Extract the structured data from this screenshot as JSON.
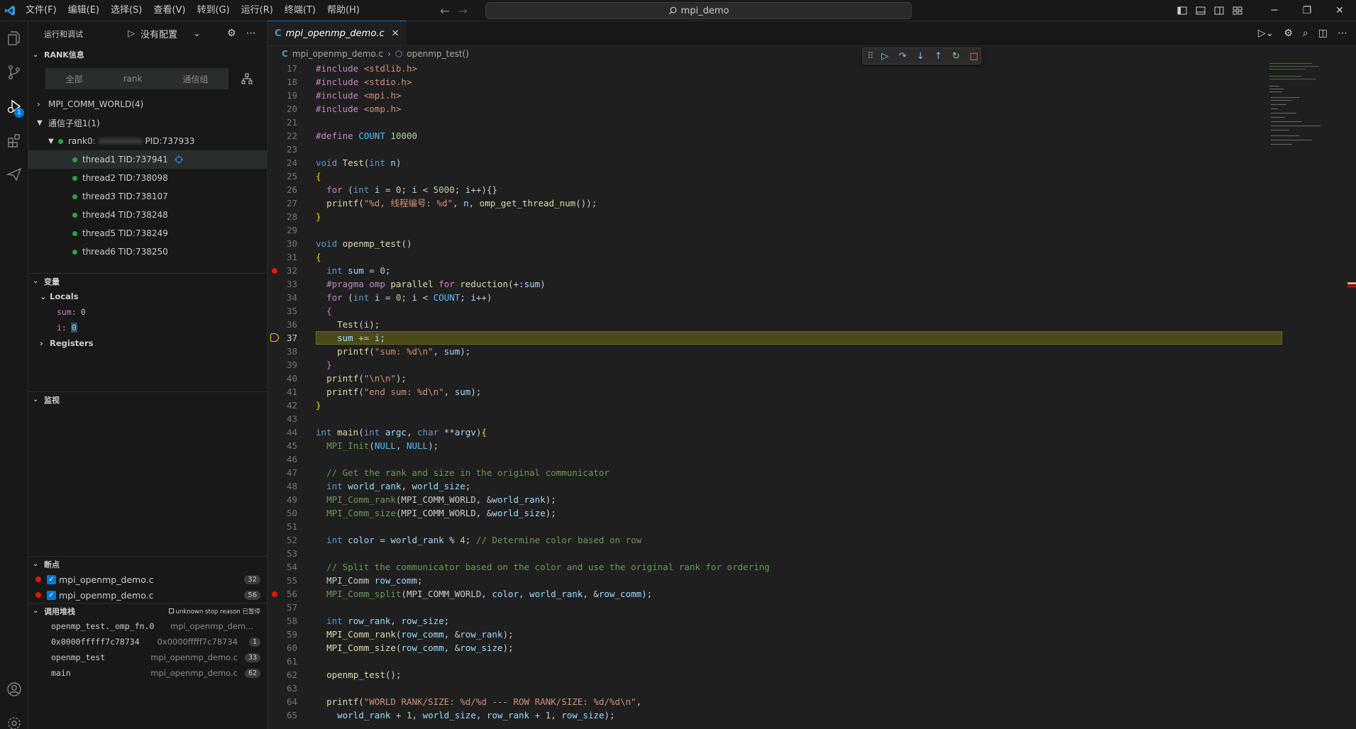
{
  "titlebar": {
    "menu": [
      "文件(F)",
      "编辑(E)",
      "选择(S)",
      "查看(V)",
      "转到(G)",
      "运行(R)",
      "终端(T)",
      "帮助(H)"
    ],
    "search": "mpi_demo"
  },
  "activity": {
    "debug_badge": "1"
  },
  "sidebar": {
    "header_title": "运行和调试",
    "run_config": "没有配置",
    "rank_section": "RANK信息",
    "tabs": [
      "全部",
      "rank",
      "通信组"
    ],
    "comm_world": "MPI_COMM_WORLD(4)",
    "subgroup": "通信子组1(1)",
    "rank_label": "rank0:",
    "pid_label": "PID:737933",
    "threads": [
      "thread1 TID:737941",
      "thread2 TID:738098",
      "thread3 TID:738107",
      "thread4 TID:738248",
      "thread5 TID:738249",
      "thread6 TID:738250"
    ],
    "variables_title": "变量",
    "locals_label": "Locals",
    "locals": [
      {
        "name": "sum:",
        "value": "0"
      },
      {
        "name": "i:",
        "value": "0"
      }
    ],
    "registers_label": "Registers",
    "watch_title": "监视",
    "breakpoints_title": "断点",
    "breakpoints": [
      {
        "file": "mpi_openmp_demo.c",
        "line": "32"
      },
      {
        "file": "mpi_openmp_demo.c",
        "line": "56"
      }
    ],
    "callstack_title": "调用堆栈",
    "callstack_status": "unknown stop reason 已暂停",
    "callstack": [
      {
        "fn": "openmp_test._omp_fn.0",
        "file": "mpi_openmp_dem...",
        "count": ""
      },
      {
        "fn": "0x0000fffff7c78734",
        "file": "0x0000fffff7c78734",
        "count": "1"
      },
      {
        "fn": "openmp_test",
        "file": "mpi_openmp_demo.c",
        "count": "33"
      },
      {
        "fn": "main",
        "file": "mpi_openmp_demo.c",
        "count": "62"
      }
    ]
  },
  "editor": {
    "tab_title": "mpi_openmp_demo.c",
    "breadcrumb_file": "mpi_openmp_demo.c",
    "breadcrumb_symbol": "openmp_test()",
    "current_line": 37,
    "breakpoint_lines": [
      32,
      56
    ],
    "lines": [
      {
        "n": "17",
        "html": "<span class='kw2'>#include</span> <span class='inc'>&lt;stdlib.h&gt;</span>"
      },
      {
        "n": "18",
        "html": "<span class='kw2'>#include</span> <span class='inc'>&lt;stdio.h&gt;</span>"
      },
      {
        "n": "19",
        "html": "<span class='kw2'>#include</span> <span class='inc'>&lt;mpi.h&gt;</span>"
      },
      {
        "n": "20",
        "html": "<span class='kw2'>#include</span> <span class='inc'>&lt;omp.h&gt;</span>"
      },
      {
        "n": "21",
        "html": ""
      },
      {
        "n": "22",
        "html": "<span class='kw2'>#define</span> <span class='mac'>COUNT</span> <span class='num2'>10000</span>"
      },
      {
        "n": "23",
        "html": ""
      },
      {
        "n": "24",
        "html": "<span class='kw'>void</span> <span class='fnc'>Test</span>(<span class='kw'>int</span> <span class='var'>n</span>)"
      },
      {
        "n": "25",
        "html": "<span style='color:#ffd700'>{</span>"
      },
      {
        "n": "26",
        "html": "  <span class='kw2'>for</span> (<span class='kw'>int</span> <span class='var'>i</span> = <span class='num2'>0</span>; <span class='var'>i</span> &lt; <span class='num2'>5000</span>; <span class='var'>i</span>++){}"
      },
      {
        "n": "27",
        "html": "  <span class='fnc'>printf</span>(<span class='str'>\"%d, 线程编号: %d\"</span>, <span class='var'>n</span>, <span class='fnc'>omp_get_thread_num</span>());"
      },
      {
        "n": "28",
        "html": "<span style='color:#ffd700'>}</span>"
      },
      {
        "n": "29",
        "html": ""
      },
      {
        "n": "30",
        "html": "<span class='kw'>void</span> <span class='fnc'>openmp_test</span>()"
      },
      {
        "n": "31",
        "html": "<span style='color:#ffd700'>{</span>"
      },
      {
        "n": "32",
        "html": "  <span class='kw'>int</span> <span class='var'>sum</span> = <span class='num2'>0</span>;"
      },
      {
        "n": "33",
        "html": "  <span class='kw2'>#pragma</span> <span class='kw2'>omp</span> <span class='fnc'>parallel</span> <span class='kw2'>for</span> <span class='fnc'>reduction</span>(+:<span class='var'>sum</span>)"
      },
      {
        "n": "34",
        "html": "  <span class='kw2'>for</span> (<span class='kw'>int</span> <span class='var'>i</span> = <span class='num2'>0</span>; <span class='var'>i</span> &lt; <span class='mac'>COUNT</span>; <span class='var'>i</span>++)"
      },
      {
        "n": "35",
        "html": "  <span style='color:#da70d6'>{</span>"
      },
      {
        "n": "36",
        "html": "    <span class='fnc'>Test</span>(<span class='var'>i</span>);"
      },
      {
        "n": "37",
        "html": "    <span class='var'>sum</span> += <span class='var'>i</span>;"
      },
      {
        "n": "38",
        "html": "    <span class='fnc'>printf</span>(<span class='str'>\"sum: %d\\n\"</span>, <span class='var'>sum</span>);"
      },
      {
        "n": "39",
        "html": "  <span style='color:#da70d6'>}</span>"
      },
      {
        "n": "40",
        "html": "  <span class='fnc'>printf</span>(<span class='str'>\"\\n\\n\"</span>);"
      },
      {
        "n": "41",
        "html": "  <span class='fnc'>printf</span>(<span class='str'>\"end sum: %d\\n\"</span>, <span class='var'>sum</span>);"
      },
      {
        "n": "42",
        "html": "<span style='color:#ffd700'>}</span>"
      },
      {
        "n": "43",
        "html": ""
      },
      {
        "n": "44",
        "html": "<span class='kw'>int</span> <span class='fnc'>main</span>(<span class='kw'>int</span> <span class='var'>argc</span>, <span class='kw'>char</span> **<span class='var'>argv</span>)<span style='color:#ffd700'>{</span>"
      },
      {
        "n": "45",
        "html": "  <span class='cm'>MPI_Init</span>(<span class='mac'>NULL</span>, <span class='mac'>NULL</span>);"
      },
      {
        "n": "46",
        "html": ""
      },
      {
        "n": "47",
        "html": "  <span class='cm'>// Get the rank and size in the original communicator</span>"
      },
      {
        "n": "48",
        "html": "  <span class='kw'>int</span> <span class='var'>world_rank</span>, <span class='var'>world_size</span>;"
      },
      {
        "n": "49",
        "html": "  <span class='cm'>MPI_Comm_rank</span>(MPI_COMM_WORLD, &amp;<span class='var'>world_rank</span>);"
      },
      {
        "n": "50",
        "html": "  <span class='cm'>MPI_Comm_size</span>(MPI_COMM_WORLD, &amp;<span class='var'>world_size</span>);"
      },
      {
        "n": "51",
        "html": ""
      },
      {
        "n": "52",
        "html": "  <span class='kw'>int</span> <span class='var'>color</span> = <span class='var'>world_rank</span> % <span class='num2'>4</span>; <span class='cm'>// Determine color based on row</span>"
      },
      {
        "n": "53",
        "html": ""
      },
      {
        "n": "54",
        "html": "  <span class='cm'>// Split the communicator based on the color and use the original rank for ordering</span>"
      },
      {
        "n": "55",
        "html": "  MPI_Comm <span class='var'>row_comm</span>;"
      },
      {
        "n": "56",
        "html": "  <span class='cm'>MPI_Comm_split</span>(MPI_COMM_WORLD, <span class='var'>color</span>, <span class='var'>world_rank</span>, &amp;<span class='var'>row_comm</span>);"
      },
      {
        "n": "57",
        "html": ""
      },
      {
        "n": "58",
        "html": "  <span class='kw'>int</span> <span class='var'>row_rank</span>, <span class='var'>row_size</span>;"
      },
      {
        "n": "59",
        "html": "  <span class='fnc'>MPI_Comm_rank</span>(<span class='var'>row_comm</span>, &amp;<span class='var'>row_rank</span>);"
      },
      {
        "n": "60",
        "html": "  <span class='fnc'>MPI_Comm_size</span>(<span class='var'>row_comm</span>, &amp;<span class='var'>row_size</span>);"
      },
      {
        "n": "61",
        "html": ""
      },
      {
        "n": "62",
        "html": "  <span class='fnc'>openmp_test</span>();"
      },
      {
        "n": "63",
        "html": ""
      },
      {
        "n": "64",
        "html": "  <span class='fnc'>printf</span>(<span class='str'>\"WORLD RANK/SIZE: %d/%d --- ROW RANK/SIZE: %d/%d\\n\"</span>,"
      },
      {
        "n": "65",
        "html": "    <span class='var'>world_rank</span> + <span class='num2'>1</span>, <span class='var'>world_size</span>, <span class='var'>row_rank</span> + <span class='num2'>1</span>, <span class='var'>row_size</span>);"
      }
    ]
  },
  "colors": {
    "accent": "#0078d4",
    "breakpoint": "#e51400",
    "thread_ok": "#2ea043",
    "current_line": "#4b4b18"
  }
}
